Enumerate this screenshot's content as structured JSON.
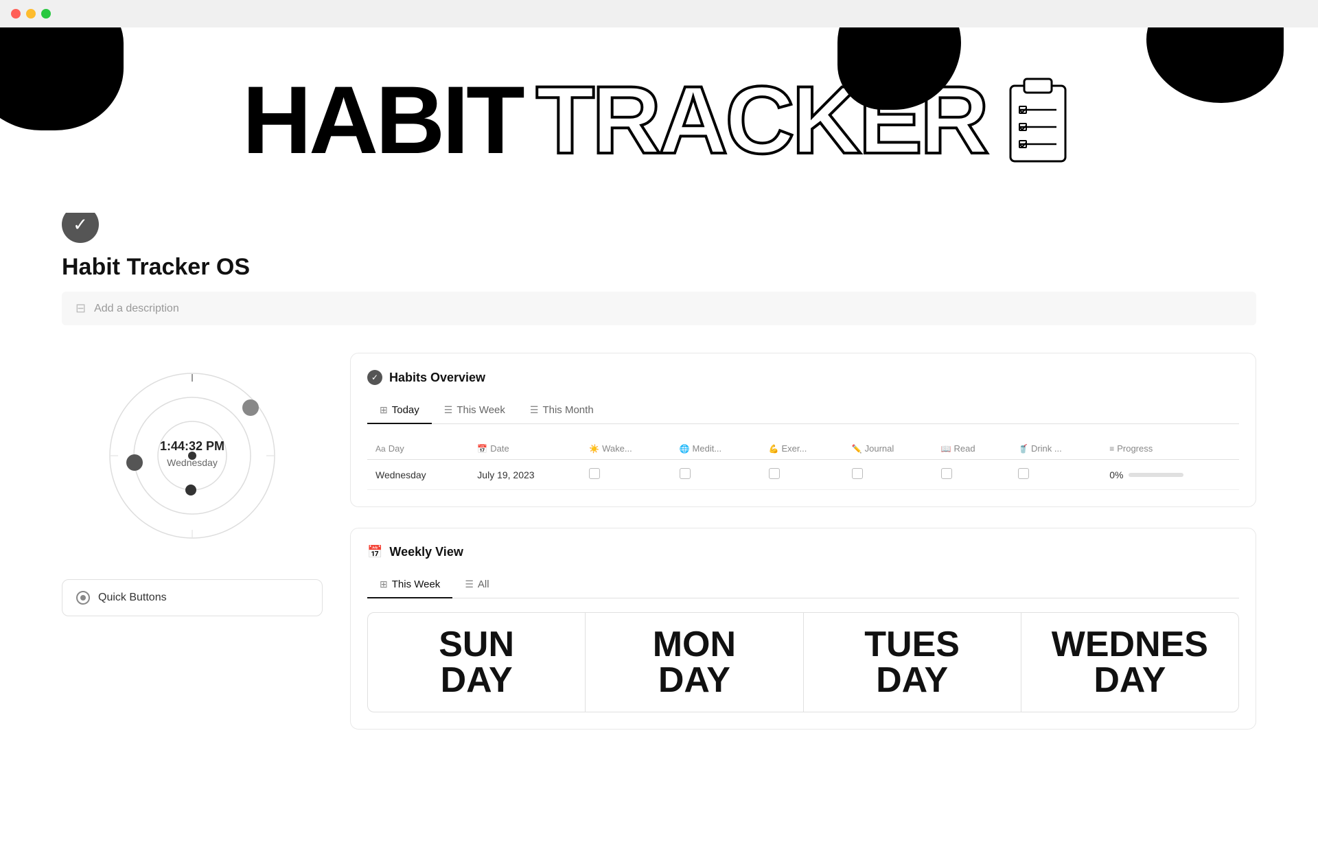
{
  "titlebar": {
    "buttons": [
      "close",
      "minimize",
      "maximize"
    ]
  },
  "hero": {
    "habit_text": "HABIT",
    "tracker_text": "TRACKER"
  },
  "page": {
    "icon": "✓",
    "title": "Habit Tracker OS",
    "description_placeholder": "Add a description"
  },
  "habits_overview": {
    "section_title": "Habits Overview",
    "tabs": [
      {
        "label": "Today",
        "active": true,
        "icon": "grid"
      },
      {
        "label": "This Week",
        "active": false,
        "icon": "table"
      },
      {
        "label": "This Month",
        "active": false,
        "icon": "table"
      }
    ],
    "table": {
      "columns": [
        {
          "icon": "Aa",
          "label": "Day"
        },
        {
          "icon": "📅",
          "label": "Date"
        },
        {
          "icon": "☀️",
          "label": "Wake..."
        },
        {
          "icon": "🌐",
          "label": "Medit..."
        },
        {
          "icon": "💪",
          "label": "Exer..."
        },
        {
          "icon": "✏️",
          "label": "Journal"
        },
        {
          "icon": "📖",
          "label": "Read"
        },
        {
          "icon": "🥤",
          "label": "Drink ..."
        },
        {
          "icon": "≡",
          "label": "Progress"
        }
      ],
      "rows": [
        {
          "day": "Wednesday",
          "date": "July 19, 2023",
          "wake": false,
          "meditate": false,
          "exercise": false,
          "journal": false,
          "read": false,
          "drink": false,
          "progress": "0%",
          "progress_pct": 0
        }
      ]
    }
  },
  "weekly_view": {
    "section_title": "Weekly View",
    "tabs": [
      {
        "label": "This Week",
        "active": true,
        "icon": "grid"
      },
      {
        "label": "All",
        "active": false,
        "icon": "table"
      }
    ],
    "days": [
      {
        "name": "SUN",
        "name2": "DAY"
      },
      {
        "name": "MON",
        "name2": "DAY"
      },
      {
        "name": "TUES",
        "name2": "DAY"
      },
      {
        "name": "WEDNES",
        "name2": "DAY"
      }
    ]
  },
  "clock": {
    "time": "1:44:32 PM",
    "day": "Wednesday"
  },
  "quick_buttons": {
    "label": "Quick Buttons"
  }
}
